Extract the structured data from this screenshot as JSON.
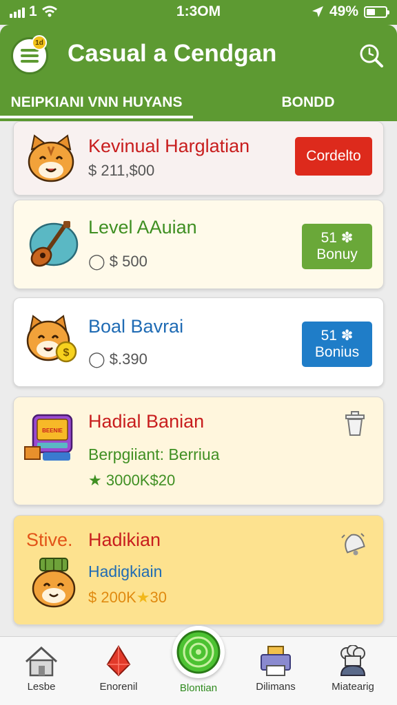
{
  "status_bar": {
    "signal_text": "1",
    "time": "1:3OM",
    "battery_text": "49%"
  },
  "header": {
    "title": "Casual a Cendgan",
    "menu_badge": "1d",
    "tabs": [
      {
        "label": "NEIPKIANI VNN HUYANS",
        "active": true
      },
      {
        "label": "BONDD",
        "active": false
      }
    ]
  },
  "cards": [
    {
      "title": "Kevinual Harglatian",
      "subtitle": "$ 211,$00",
      "button_label": "Cordelto",
      "colors": {
        "background": "#f8f1f0",
        "title": "#c81e1e",
        "button": "#dd2a1c"
      },
      "art_icon": "cat-face-icon"
    },
    {
      "title": "Level AAuian",
      "subtitle": "$ 500",
      "button_top": "51",
      "button_bottom": "Bonuy",
      "colors": {
        "background": "#fffaea",
        "title": "#3f8f22",
        "button": "#6aa839"
      },
      "art_icon": "guitar-icon"
    },
    {
      "title": "Boal Bavrai",
      "subtitle": "$.390",
      "button_top": "51",
      "button_bottom": "Bonius",
      "colors": {
        "background": "#ffffff",
        "title": "#1f6bb4",
        "button": "#1f7dc8"
      },
      "art_icon": "cat-coin-icon"
    },
    {
      "title": "Hadial Banian",
      "subtitle2": "Berpgiiant: Berriua",
      "meta": "3000K$20",
      "art_sign": "BEENIE",
      "colors": {
        "background": "#fff6dd",
        "title": "#c81e1e",
        "subtitle2": "#3f8f22",
        "meta": "#3f8f22"
      },
      "art_icon": "arcade-icon",
      "corner_icon": "trash-icon"
    },
    {
      "prefix": "Stive.",
      "title": "Hadikian",
      "subtitle2": "Hadigkiain",
      "meta": "200K",
      "meta_star_value": "30",
      "colors": {
        "background": "#fde28f",
        "title": "#c81e1e",
        "prefix": "#e25418",
        "subtitle2": "#1f6bb4",
        "meta": "#e08a10"
      },
      "art_icon": "cat-hat-icon",
      "corner_icon": "bell-icon"
    }
  ],
  "bottom_nav": [
    {
      "label": "Lesbe",
      "icon": "house-icon"
    },
    {
      "label": "Enorenil",
      "icon": "gem-icon"
    },
    {
      "label": "Blontian",
      "icon": "spiral-icon",
      "active": true
    },
    {
      "label": "Dilimans",
      "icon": "printer-icon"
    },
    {
      "label": "Miatearig",
      "icon": "cook-icon"
    }
  ]
}
